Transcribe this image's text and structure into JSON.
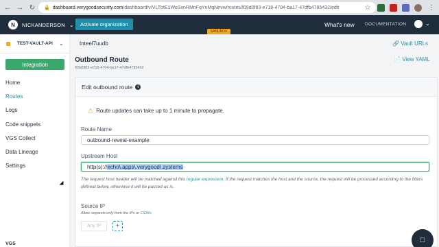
{
  "browser": {
    "url_host": "dashboard.verygoodsecurity.com",
    "url_path": "/dashboard/v/VLTbtE1WoSxnRMnFqYnMqNevw/routes/f09d0f83-e718-4704-ba17-47dfb4785432/edit"
  },
  "header": {
    "org_name": "NICKANDERSON",
    "activate_label": "Activate organization",
    "sandbox_label": "SANDBOX",
    "whats_new": "What's new",
    "documentation": "DOCUMENTATION"
  },
  "sidebar": {
    "vault_name": "TEST-VAULT-API",
    "integration_label": "Integration",
    "items": [
      {
        "label": "Home"
      },
      {
        "label": "Routes"
      },
      {
        "label": "Logs"
      },
      {
        "label": "Code snippets"
      },
      {
        "label": "VGS Collect"
      },
      {
        "label": "Data Lineage"
      },
      {
        "label": "Settings"
      }
    ],
    "footer": "VGS"
  },
  "main": {
    "route_id": "tnteel7uudb",
    "vault_urls": "Vault URLs",
    "title": "Outbound Route",
    "uuid": "f09d0f83-e718-4704-ba17-47dfb4785432",
    "view_yaml": "View YAML",
    "card": {
      "header": "Edit outbound route",
      "warning": "Route updates can take up to 1 minute to propagate.",
      "route_name_label": "Route Name",
      "route_name_value": "outbound-reveal-example",
      "upstream_label": "Upstream Host",
      "upstream_prefix": "http(s)://",
      "upstream_selected": "echo\\.apps\\.verygood\\.systems",
      "help_1": "The request host header will be matched against this ",
      "help_link": "regular expression",
      "help_2": ". If the request matches the host and the source, the request will be processed according to the filters defined below, otherwise it will be passed as is.",
      "source_label": "Source IP",
      "source_help": "Allow requests only from the IPs or ",
      "source_help_link": "CIDRs",
      "any_ip": "Any IP",
      "add": "+"
    }
  }
}
